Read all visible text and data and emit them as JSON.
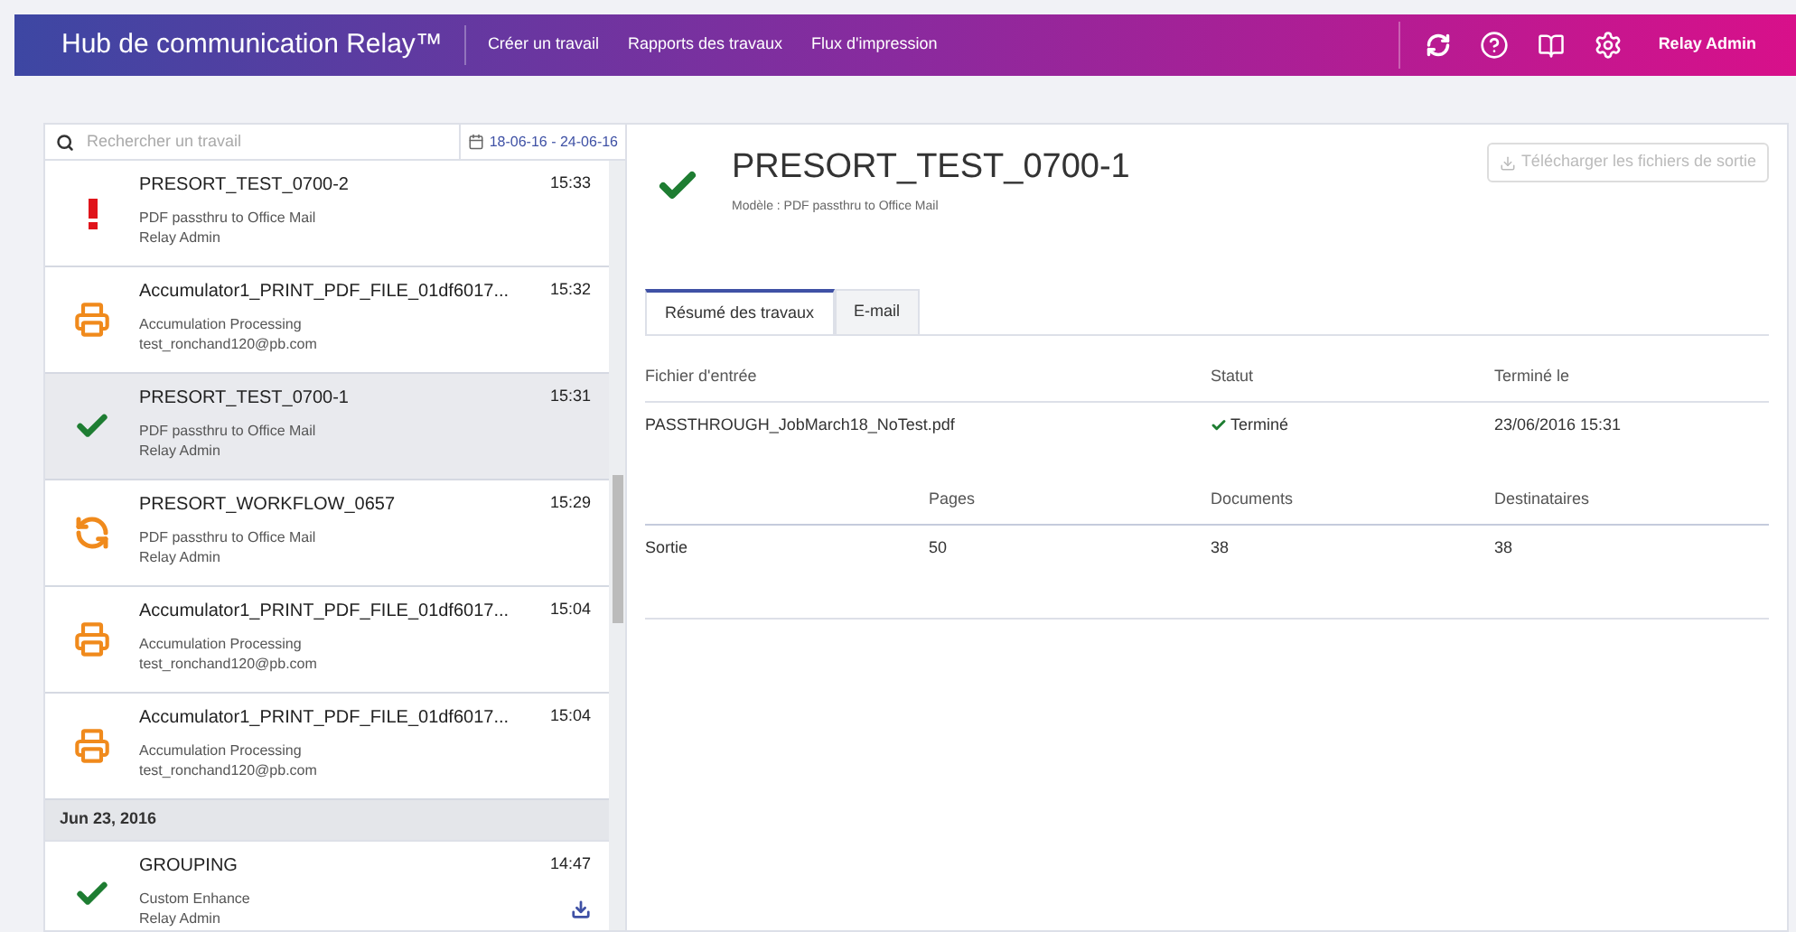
{
  "header": {
    "title": "Hub de communication Relay™",
    "nav": [
      "Créer un travail",
      "Rapports des travaux",
      "Flux d'impression"
    ],
    "user": "Relay Admin"
  },
  "search": {
    "placeholder": "Rechercher un travail",
    "date_range": "18-06-16 - 24-06-16"
  },
  "jobs": [
    {
      "kind": "error",
      "name": "PRESORT_TEST_0700-2",
      "time": "15:33",
      "template": "PDF passthru to Office Mail",
      "user": "Relay Admin",
      "selected": false,
      "download": false
    },
    {
      "kind": "print",
      "name": "Accumulator1_PRINT_PDF_FILE_01df6017...",
      "time": "15:32",
      "template": "Accumulation Processing",
      "user": "test_ronchand120@pb.com",
      "selected": false,
      "download": false
    },
    {
      "kind": "success",
      "name": "PRESORT_TEST_0700-1",
      "time": "15:31",
      "template": "PDF passthru to Office Mail",
      "user": "Relay Admin",
      "selected": true,
      "download": false
    },
    {
      "kind": "sync",
      "name": "PRESORT_WORKFLOW_0657",
      "time": "15:29",
      "template": "PDF passthru to Office Mail",
      "user": "Relay Admin",
      "selected": false,
      "download": false
    },
    {
      "kind": "print",
      "name": "Accumulator1_PRINT_PDF_FILE_01df6017...",
      "time": "15:04",
      "template": "Accumulation Processing",
      "user": "test_ronchand120@pb.com",
      "selected": false,
      "download": false
    },
    {
      "kind": "print",
      "name": "Accumulator1_PRINT_PDF_FILE_01df6017...",
      "time": "15:04",
      "template": "Accumulation Processing",
      "user": "test_ronchand120@pb.com",
      "selected": false,
      "download": false
    },
    {
      "kind": "date",
      "label": "Jun 23, 2016"
    },
    {
      "kind": "success",
      "name": "GROUPING",
      "time": "14:47",
      "template": "Custom Enhance",
      "user": "Relay Admin",
      "selected": false,
      "download": true
    }
  ],
  "detail": {
    "title": "PRESORT_TEST_0700-1",
    "kind": "success",
    "model": "Modèle : PDF passthru to Office Mail",
    "download_button": {
      "label": "Télécharger les fichiers de sortie",
      "disabled": true
    },
    "tabs": [
      {
        "label": "Résumé des travaux",
        "selected": true
      },
      {
        "label": "E-mail",
        "selected": false
      }
    ],
    "input_table": {
      "columns": [
        "Fichier d'entrée",
        "Statut",
        "Terminé le"
      ],
      "row": {
        "file": "PASSTHROUGH_JobMarch18_NoTest.pdf",
        "status": "Terminé",
        "done": "23/06/2016 15:31"
      }
    },
    "output_table": {
      "columns": [
        "",
        "Pages",
        "Documents",
        "Destinataires"
      ],
      "row": [
        "Sortie",
        "50",
        "38",
        "38"
      ]
    }
  }
}
